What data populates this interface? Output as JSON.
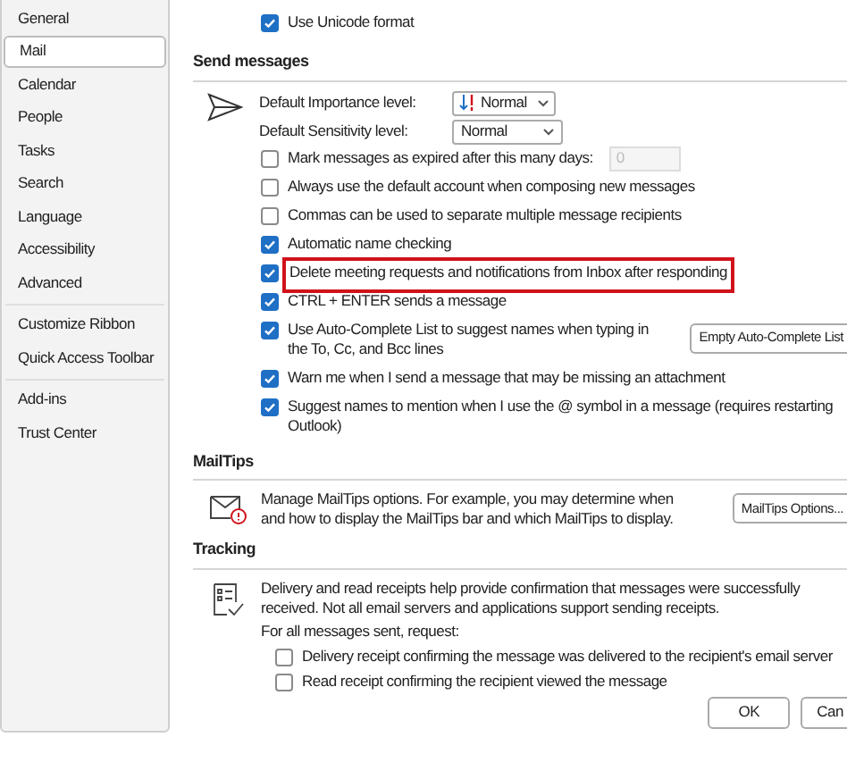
{
  "sidebar": {
    "groups": [
      [
        {
          "label": "General",
          "selected": false
        },
        {
          "label": "Mail",
          "selected": true
        },
        {
          "label": "Calendar",
          "selected": false
        },
        {
          "label": "People",
          "selected": false
        },
        {
          "label": "Tasks",
          "selected": false
        },
        {
          "label": "Search",
          "selected": false
        },
        {
          "label": "Language",
          "selected": false
        },
        {
          "label": "Accessibility",
          "selected": false
        },
        {
          "label": "Advanced",
          "selected": false
        }
      ],
      [
        {
          "label": "Customize Ribbon",
          "selected": false
        },
        {
          "label": "Quick Access Toolbar",
          "selected": false
        }
      ],
      [
        {
          "label": "Add-ins",
          "selected": false
        },
        {
          "label": "Trust Center",
          "selected": false
        }
      ]
    ]
  },
  "top_option": {
    "label": "Use Unicode format",
    "checked": true
  },
  "send_messages": {
    "title": "Send messages",
    "importance": {
      "label": "Default Importance level:",
      "value": "Normal"
    },
    "sensitivity": {
      "label": "Default Sensitivity level:",
      "value": "Normal"
    },
    "expire": {
      "label": "Mark messages as expired after this many days:",
      "checked": false,
      "value": "0"
    },
    "options": [
      {
        "label": "Always use the default account when composing new messages",
        "checked": false,
        "highlighted": false
      },
      {
        "label": "Commas can be used to separate multiple message recipients",
        "checked": false,
        "highlighted": false
      },
      {
        "label": "Automatic name checking",
        "checked": true,
        "highlighted": false
      },
      {
        "label": "Delete meeting requests and notifications from Inbox after responding",
        "checked": true,
        "highlighted": true
      },
      {
        "label": "CTRL + ENTER sends a message",
        "checked": true,
        "highlighted": false
      }
    ],
    "autocomplete": {
      "label": "Use Auto-Complete List to suggest names when typing in the To, Cc, and Bcc lines",
      "checked": true,
      "button": "Empty Auto-Complete List"
    },
    "options_2": [
      {
        "label": "Warn me when I send a message that may be missing an attachment",
        "checked": true
      },
      {
        "label": "Suggest names to mention when I use the @ symbol in a message (requires restarting Outlook)",
        "checked": true
      }
    ]
  },
  "mailtips": {
    "title": "MailTips",
    "text": "Manage MailTips options. For example, you may determine when and how to display the MailTips bar and which MailTips to display.",
    "button": "MailTips Options..."
  },
  "tracking": {
    "title": "Tracking",
    "text": "Delivery and read receipts help provide confirmation that messages were successfully received. Not all email servers and applications support sending receipts.",
    "request_label": "For all messages sent, request:",
    "options": [
      {
        "label": "Delivery receipt confirming the message was delivered to the recipient's email server",
        "checked": false
      },
      {
        "label": "Read receipt confirming the recipient viewed the message",
        "checked": false
      }
    ]
  },
  "buttons": [
    "OK",
    "Can"
  ]
}
